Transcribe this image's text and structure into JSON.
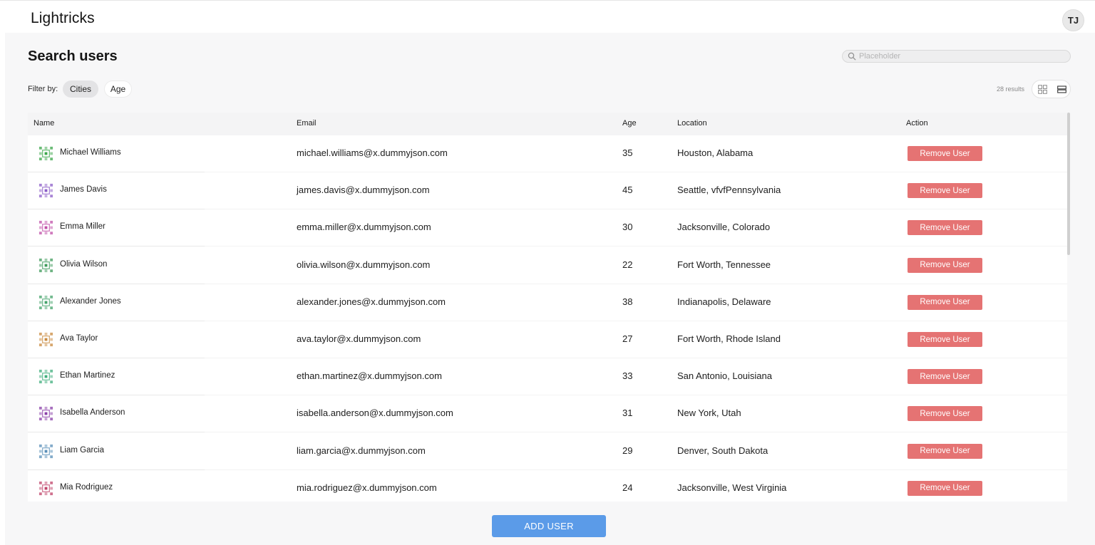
{
  "app": {
    "brand": "Lightricks",
    "user_initials": "TJ"
  },
  "page": {
    "title": "Search users"
  },
  "search": {
    "placeholder": "Placeholder",
    "value": ""
  },
  "filter": {
    "label": "Filter by:",
    "chips": [
      {
        "label": "Cities",
        "active": true
      },
      {
        "label": "Age",
        "active": false
      }
    ]
  },
  "results": {
    "count_text": "28 results"
  },
  "view_toggle": {
    "options": [
      "grid",
      "list"
    ],
    "active": "list"
  },
  "table": {
    "columns": [
      "Name",
      "Email",
      "Age",
      "Location",
      "Action"
    ],
    "rows": [
      {
        "name": "Michael Williams",
        "email": "michael.williams@x.dummyjson.com",
        "age": "35",
        "location": "Houston, Alabama",
        "action": "Remove User",
        "avatar_color": "#3aa64a"
      },
      {
        "name": "James Davis",
        "email": "james.davis@x.dummyjson.com",
        "age": "45",
        "location": "Seattle, vfvfPennsylvania",
        "action": "Remove User",
        "avatar_color": "#8b5cc7"
      },
      {
        "name": "Emma Miller",
        "email": "emma.miller@x.dummyjson.com",
        "age": "30",
        "location": "Jacksonville, Colorado",
        "action": "Remove User",
        "avatar_color": "#c04fa8"
      },
      {
        "name": "Olivia Wilson",
        "email": "olivia.wilson@x.dummyjson.com",
        "age": "22",
        "location": "Fort Worth, Tennessee",
        "action": "Remove User",
        "avatar_color": "#3d9a5a"
      },
      {
        "name": "Alexander Jones",
        "email": "alexander.jones@x.dummyjson.com",
        "age": "38",
        "location": "Indianapolis, Delaware",
        "action": "Remove User",
        "avatar_color": "#43a36a"
      },
      {
        "name": "Ava Taylor",
        "email": "ava.taylor@x.dummyjson.com",
        "age": "27",
        "location": "Fort Worth, Rhode Island",
        "action": "Remove User",
        "avatar_color": "#c98a3e"
      },
      {
        "name": "Ethan Martinez",
        "email": "ethan.martinez@x.dummyjson.com",
        "age": "33",
        "location": "San Antonio, Louisiana",
        "action": "Remove User",
        "avatar_color": "#3fae7c"
      },
      {
        "name": "Isabella Anderson",
        "email": "isabella.anderson@x.dummyjson.com",
        "age": "31",
        "location": "New York, Utah",
        "action": "Remove User",
        "avatar_color": "#8a3fa8"
      },
      {
        "name": "Liam Garcia",
        "email": "liam.garcia@x.dummyjson.com",
        "age": "29",
        "location": "Denver, South Dakota",
        "action": "Remove User",
        "avatar_color": "#5a8fb8"
      },
      {
        "name": "Mia Rodriguez",
        "email": "mia.rodriguez@x.dummyjson.com",
        "age": "24",
        "location": "Jacksonville, West Virginia",
        "action": "Remove User",
        "avatar_color": "#c0436a"
      }
    ]
  },
  "add_button": {
    "label": "ADD USER"
  },
  "colors": {
    "remove_button": "#e57373",
    "add_button": "#5b9be8",
    "panel_bg": "#f7f7f8"
  }
}
